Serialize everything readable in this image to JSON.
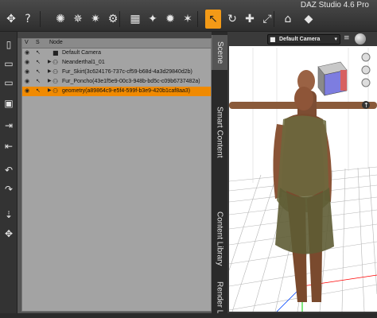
{
  "app": {
    "title": "DAZ Studio 4.6 Pro"
  },
  "toolbar": {
    "buttons": [
      {
        "name": "universal-tool-icon",
        "glyph": "✥"
      },
      {
        "name": "help-icon",
        "glyph": "?"
      },
      {
        "name": "light-icon",
        "glyph": "✺"
      },
      {
        "name": "spot-light-icon",
        "glyph": "✵"
      },
      {
        "name": "add-light-icon",
        "glyph": "✷"
      },
      {
        "name": "gear-icon",
        "glyph": "⚙"
      },
      {
        "name": "node-selection-icon",
        "glyph": "▦"
      },
      {
        "name": "joint-editor-icon",
        "glyph": "✦"
      },
      {
        "name": "spotlight-tool-icon",
        "glyph": "✹"
      },
      {
        "name": "region-navigator-icon",
        "glyph": "✶"
      },
      {
        "name": "pointer-icon",
        "glyph": "↖"
      },
      {
        "name": "rotate-icon",
        "glyph": "↻"
      },
      {
        "name": "translate-icon",
        "glyph": "✚"
      },
      {
        "name": "scale-icon",
        "glyph": "⤢"
      },
      {
        "name": "geometry-editor-icon",
        "glyph": "⌂"
      },
      {
        "name": "cube-icon",
        "glyph": "◆"
      }
    ]
  },
  "lefttools": [
    {
      "name": "new-file-icon",
      "glyph": "▯"
    },
    {
      "name": "open-folder-icon",
      "glyph": "▭"
    },
    {
      "name": "open-recent-icon",
      "glyph": "▭"
    },
    {
      "name": "save-icon",
      "glyph": "▣"
    },
    {
      "name": "import-icon",
      "glyph": "⇥"
    },
    {
      "name": "export-icon",
      "glyph": "⇤"
    },
    {
      "name": "undo-icon",
      "glyph": "↶"
    },
    {
      "name": "redo-icon",
      "glyph": "↷"
    },
    {
      "name": "pin-icon",
      "glyph": "⇣"
    },
    {
      "name": "snap-icon",
      "glyph": "✥"
    }
  ],
  "scene": {
    "columns": {
      "visible": "V",
      "selectable": "S",
      "node": "Node"
    },
    "rows": [
      {
        "label": "Default Camera",
        "expandable": false,
        "selected": false
      },
      {
        "label": "Neanderthal1_01",
        "expandable": true,
        "selected": false
      },
      {
        "label": "Fur_Skirt(3c624176-737c-cf59-b68d-4a3d29840d2b)",
        "expandable": true,
        "selected": false
      },
      {
        "label": "Fur_Poncho(43e1f5e9-00c3-948b-bd5c-c09b6737482a)",
        "expandable": true,
        "selected": false
      },
      {
        "label": "geometry(a89864c9-e5f4-599f-b3e9-420b1caf8aa3)",
        "expandable": true,
        "selected": true
      }
    ]
  },
  "tabs": [
    {
      "label": "Scene",
      "active": true
    },
    {
      "label": "Smart Content",
      "active": false
    },
    {
      "label": "Content Library",
      "active": false
    },
    {
      "label": "Render Library",
      "active": false
    }
  ],
  "viewport": {
    "camera": "Default Camera",
    "camera_icon": "camera-icon",
    "menu_icon": "viewport-menu-icon"
  },
  "colors": {
    "selection": "#f08a00",
    "active_tool": "#f39a17",
    "axis_x": "#ff0000",
    "axis_y": "#00d000",
    "axis_z": "#0044ff"
  }
}
